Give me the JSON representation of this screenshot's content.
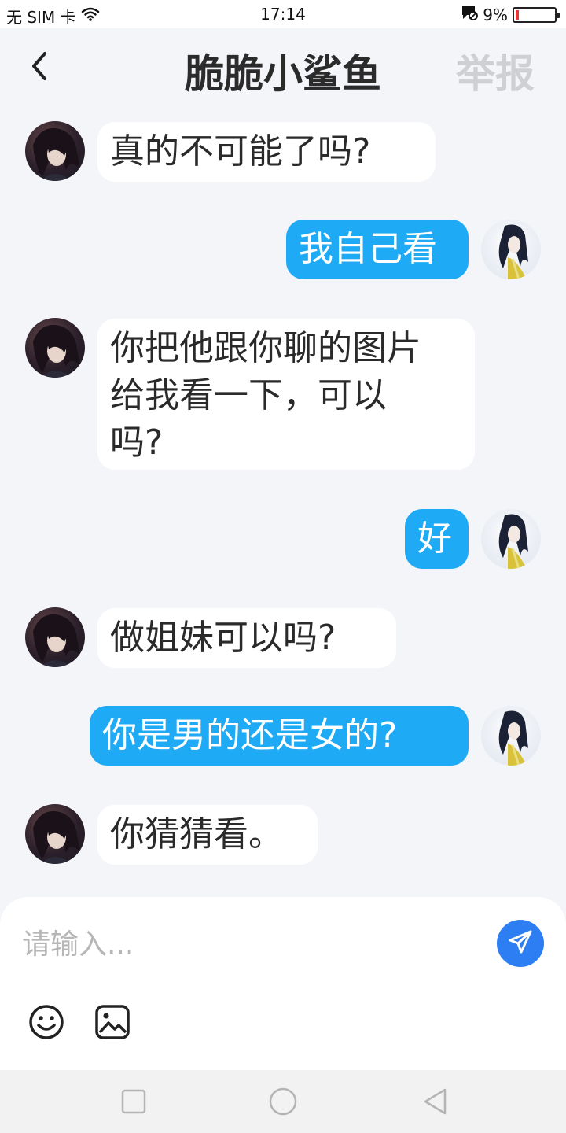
{
  "status_bar": {
    "carrier": "无 SIM 卡",
    "time": "17:14",
    "battery_percent": "9%",
    "battery_level": 0.09,
    "battery_color": "#e53935"
  },
  "header": {
    "title": "脆脆小鲨鱼",
    "report_label": "举报",
    "back_icon": "chevron-left-icon"
  },
  "messages": [
    {
      "side": "left",
      "text": "真的不可能了吗?"
    },
    {
      "side": "right",
      "text": "我自己看"
    },
    {
      "side": "left",
      "lines": [
        "你把他跟你聊的图片",
        "给我看一下，可以",
        "吗?"
      ]
    },
    {
      "side": "right",
      "text": "好"
    },
    {
      "side": "left",
      "text": "做姐妹可以吗?"
    },
    {
      "side": "right",
      "text": "你是男的还是女的?"
    },
    {
      "side": "left",
      "text": "你猜猜看。"
    }
  ],
  "input": {
    "placeholder": "请输入...",
    "value": "",
    "send_icon": "send-icon",
    "emoji_icon": "smile-icon",
    "image_icon": "image-icon"
  },
  "colors": {
    "accent_bubble": "#1eaaf5",
    "send_button": "#2c7ef2",
    "background": "#f4f5f9"
  },
  "nav_bar": {
    "icons": [
      "square-icon",
      "circle-icon",
      "triangle-back-icon"
    ]
  }
}
